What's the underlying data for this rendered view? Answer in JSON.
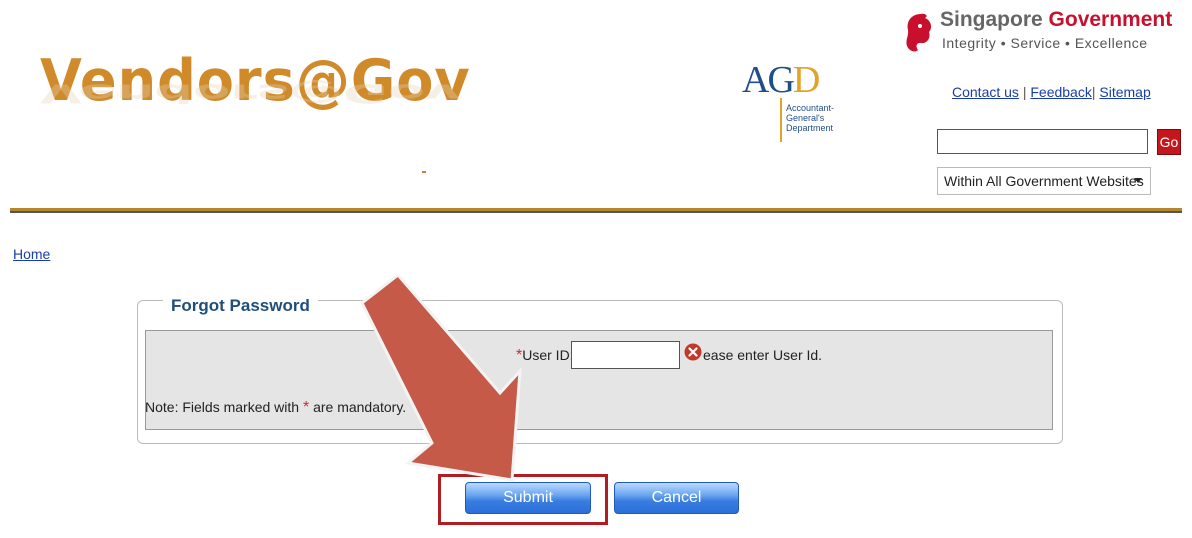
{
  "logo": {
    "text": "Vendors@Gov"
  },
  "agd": {
    "mark_a": "AG",
    "mark_d": "D",
    "line1": "Accountant-",
    "line2": "General's",
    "line3": "Department"
  },
  "sg": {
    "title_grey": "Singapore",
    "title_red": "Government",
    "tagline": "Integrity • Service • Excellence"
  },
  "toplinks": {
    "contact": "Contact us",
    "feedback": "Feedback",
    "sitemap": "Sitemap",
    "sep": "|"
  },
  "search": {
    "value": "",
    "go_label": "Go",
    "scope": "Within All Government Websites"
  },
  "breadcrumb": {
    "home": "Home"
  },
  "form": {
    "legend": "Forgot Password",
    "userid_label": "User ID:",
    "userid_value": "",
    "error_text": "ease enter User Id.",
    "note_prefix": "Note: Fields marked with ",
    "note_suffix": " are mandatory.",
    "required_mark": "*"
  },
  "buttons": {
    "submit": "Submit",
    "cancel": "Cancel"
  },
  "colors": {
    "accent_red": "#c4161c",
    "button_blue": "#3a7de0",
    "highlight": "#b01e23",
    "arrow": "#c65a49"
  }
}
